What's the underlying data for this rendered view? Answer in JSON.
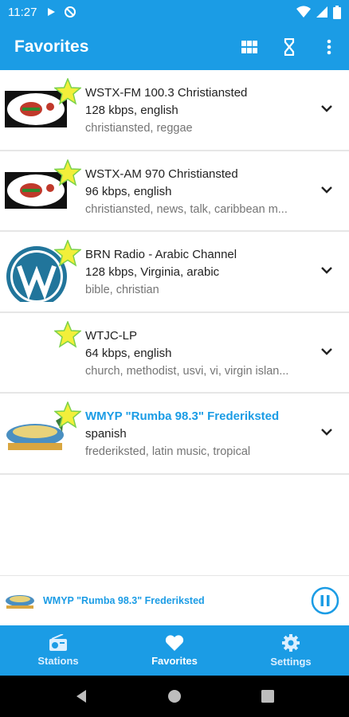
{
  "status_bar": {
    "time": "11:27",
    "icons": [
      "play-icon",
      "no-data-icon",
      "wifi-icon",
      "signal-icon",
      "battery-icon"
    ]
  },
  "app_bar": {
    "title": "Favorites",
    "actions": [
      "grid-view-icon",
      "sleep-timer-icon",
      "more-options-icon"
    ]
  },
  "stations": [
    {
      "name": "WSTX-FM 100.3 Christiansted",
      "detail": "128 kbps, english",
      "tags": "christiansted, reggae",
      "logo": "wstx-logo",
      "active": false
    },
    {
      "name": "WSTX-AM 970 Christiansted",
      "detail": "96 kbps, english",
      "tags": "christiansted, news, talk, caribbean m...",
      "logo": "wstx-logo",
      "active": false
    },
    {
      "name": "BRN Radio - Arabic Channel",
      "detail": "128 kbps, Virginia, arabic",
      "tags": "bible, christian",
      "logo": "wordpress-logo",
      "active": false
    },
    {
      "name": "WTJC-LP",
      "detail": "64 kbps, english",
      "tags": "church, methodist, usvi, vi, virgin islan...",
      "logo": "none",
      "active": false
    },
    {
      "name": "WMYP \"Rumba 98.3\" Frederiksted",
      "detail": "spanish",
      "tags": "frederiksted, latin music, tropical",
      "logo": "rumba-logo",
      "active": true
    }
  ],
  "player": {
    "title": "WMYP \"Rumba 98.3\" Frederiksted",
    "state": "playing"
  },
  "bottom_nav": [
    {
      "label": "Stations",
      "icon": "radio-icon",
      "active": false
    },
    {
      "label": "Favorites",
      "icon": "heart-icon",
      "active": true
    },
    {
      "label": "Settings",
      "icon": "gear-icon",
      "active": false
    }
  ],
  "colors": {
    "primary": "#1b9ce5",
    "star": "#f2ef3a"
  }
}
